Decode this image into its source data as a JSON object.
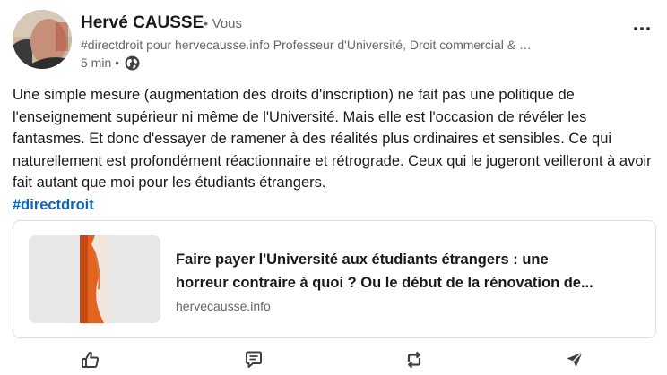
{
  "post": {
    "author_name": "Hervé CAUSSE",
    "author_dot": "•",
    "connection_degree": "Vous",
    "headline": "#directdroit pour hervecausse.info Professeur d'Université, Droit commercial & …",
    "timestamp": "5 min •",
    "visibility_icon": "globe-icon",
    "body": "Une simple mesure (augmentation des droits d'inscription) ne fait pas une politique de l'enseignement supérieur ni même de l'Université. Mais elle est l'occasion de révéler les fantasmes. Et donc d'essayer de ramener à des réalités plus ordinaires et sensibles. Ce qui naturellement est profondément réactionnaire et rétrograde. Ceux qui le jugeront veilleront à avoir fait autant que moi pour les étudiants étrangers.",
    "hashtag": "#directdroit"
  },
  "link_card": {
    "title_line1": "Faire payer l'Université aux étudiants étrangers : une",
    "title_line2": "horreur contraire à quoi ? Ou le début de la rénovation de...",
    "domain": "hervecausse.info"
  },
  "actions": [
    {
      "icon": "like-icon"
    },
    {
      "icon": "comment-icon"
    },
    {
      "icon": "repost-icon"
    },
    {
      "icon": "send-icon"
    }
  ],
  "colors": {
    "hashtag": "#0a66c2",
    "text": "#191919",
    "secondary": "#666666",
    "icons": "#404040"
  }
}
